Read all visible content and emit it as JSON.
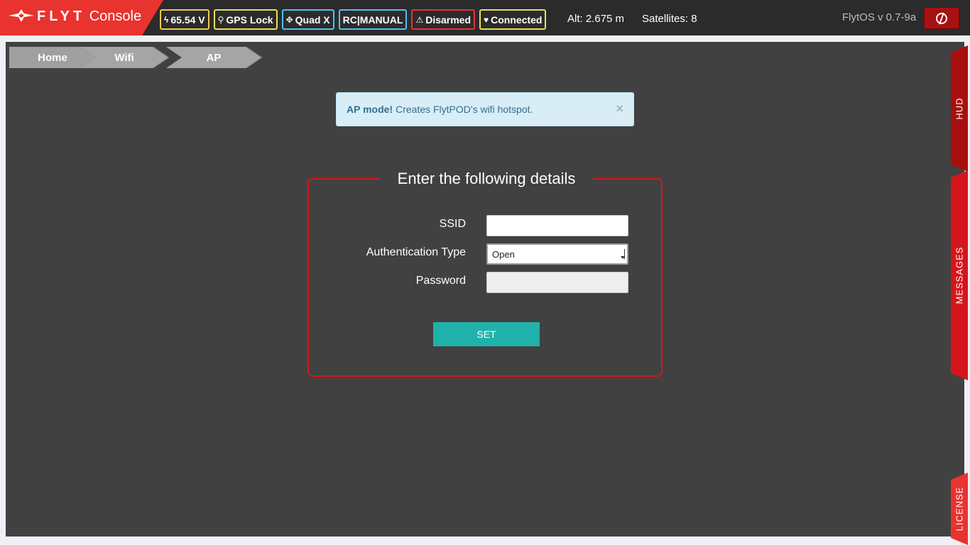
{
  "app": {
    "logo_brand": "FLYT",
    "logo_suffix": "Console",
    "version": "FlytOS v 0.7-9a"
  },
  "status": {
    "badges": [
      {
        "icon": "bolt-icon",
        "glyph": "ϟ",
        "label": "65.54 V",
        "color": "#f2c94c"
      },
      {
        "icon": "map-marker-icon",
        "glyph": "⚲",
        "label": "GPS Lock",
        "color": "#e6e05a"
      },
      {
        "icon": "quadcopter-icon",
        "glyph": "✥",
        "label": "Quad X",
        "color": "#4fc3f7"
      },
      {
        "icon": "",
        "glyph": "",
        "label": "RC|MANUAL",
        "color": "#4fc3f7"
      },
      {
        "icon": "warning-icon",
        "glyph": "⚠",
        "label": "Disarmed",
        "color": "#e8332e"
      },
      {
        "icon": "heart-icon",
        "glyph": "♥",
        "label": "Connected",
        "color": "#e6e05a"
      }
    ],
    "altitude": "Alt: 2.675 m",
    "satellites": "Satellites: 8"
  },
  "breadcrumb": [
    "Home",
    "Wifi",
    "AP"
  ],
  "alert": {
    "title": "AP mode!",
    "message": "Creates FlytPOD's wifi hotspot.",
    "close": "×"
  },
  "form": {
    "title": "Enter the following details",
    "ssid_label": "SSID",
    "ssid_value": "",
    "auth_label": "Authentication Type",
    "auth_value": "Open",
    "password_label": "Password",
    "password_value": "",
    "submit_label": "SET"
  },
  "sidetabs": {
    "hud": "HUD",
    "messages": "MESSAGES",
    "license": "LICENSE"
  },
  "colors": {
    "brand": "#e8332e",
    "topbar": "#2b2b2b",
    "panel": "#414141",
    "accent": "#20b2aa"
  }
}
